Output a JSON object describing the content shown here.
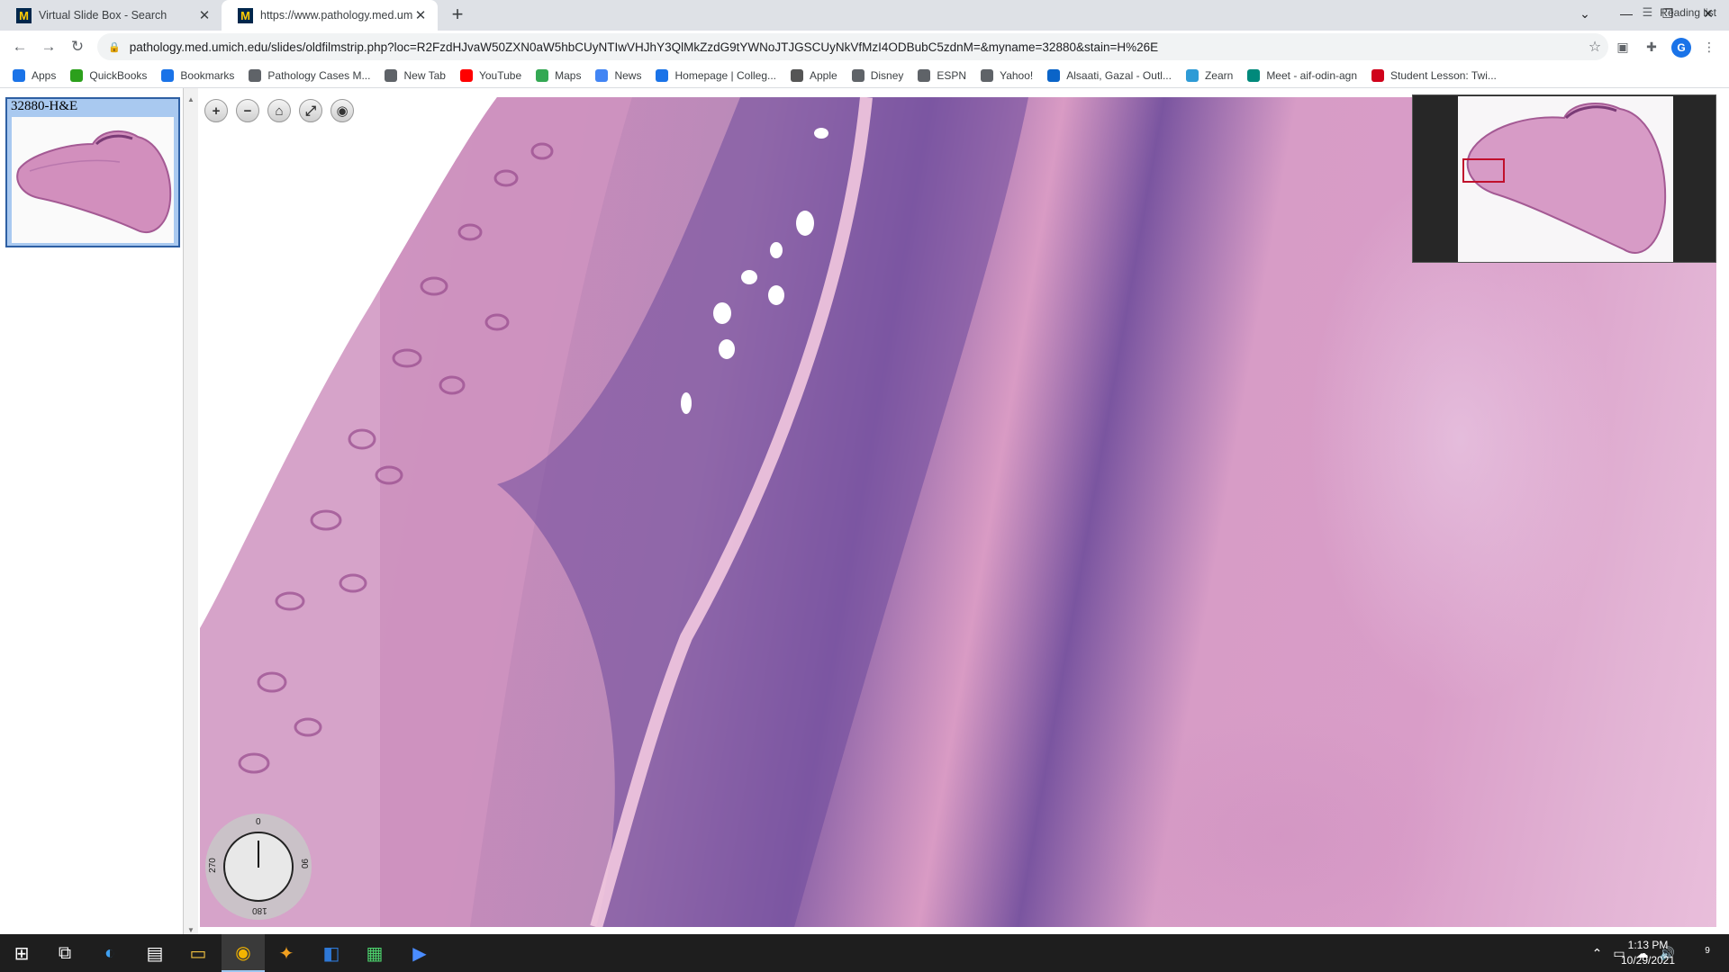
{
  "browser": {
    "tabs": [
      {
        "title": "Virtual Slide Box - Search",
        "favicon": "M",
        "active": false
      },
      {
        "title": "https://www.pathology.med.umi",
        "favicon": "M",
        "active": true
      }
    ],
    "new_tab_icon": "plus-icon",
    "url": "pathology.med.umich.edu/slides/oldfilmstrip.php?loc=R2FzdHJvaW50ZXN0aW5hbCUyNTIwVHJhY3QlMkZzdG9tYWNoJTJGSCUyNkVfMzI4ODBubC5zdnM=&myname=32880&stain=H%26E",
    "profile_initial": "G",
    "bookmarks": [
      {
        "label": "Apps",
        "icon": "apps-grid-icon",
        "color": "#1a73e8"
      },
      {
        "label": "QuickBooks",
        "icon": "quickbooks-icon",
        "color": "#2ca01c"
      },
      {
        "label": "Bookmarks",
        "icon": "star-icon",
        "color": "#1a73e8"
      },
      {
        "label": "Pathology Cases M...",
        "icon": "globe-icon",
        "color": "#5f6368"
      },
      {
        "label": "New Tab",
        "icon": "globe-icon",
        "color": "#5f6368"
      },
      {
        "label": "YouTube",
        "icon": "youtube-icon",
        "color": "#ff0000"
      },
      {
        "label": "Maps",
        "icon": "maps-pin-icon",
        "color": "#34a853"
      },
      {
        "label": "News",
        "icon": "news-icon",
        "color": "#4285f4"
      },
      {
        "label": "Homepage | Colleg...",
        "icon": "college-icon",
        "color": "#1a73e8"
      },
      {
        "label": "Apple",
        "icon": "apple-icon",
        "color": "#555555"
      },
      {
        "label": "Disney",
        "icon": "globe-icon",
        "color": "#5f6368"
      },
      {
        "label": "ESPN",
        "icon": "globe-icon",
        "color": "#5f6368"
      },
      {
        "label": "Yahoo!",
        "icon": "globe-icon",
        "color": "#5f6368"
      },
      {
        "label": "Alsaati, Gazal - Outl...",
        "icon": "outlook-icon",
        "color": "#0a64c8"
      },
      {
        "label": "Zearn",
        "icon": "zearn-icon",
        "color": "#2e9bd6"
      },
      {
        "label": "Meet - aif-odin-agn",
        "icon": "meet-icon",
        "color": "#00897b"
      },
      {
        "label": "Student Lesson: Twi...",
        "icon": "tumblr-icon",
        "color": "#d0021b"
      }
    ],
    "reading_list": "Reading list"
  },
  "viewer": {
    "slide_label": "32880-H&E",
    "zoom_controls": [
      {
        "name": "zoom-in-button",
        "icon": "plus-icon",
        "glyph": "+"
      },
      {
        "name": "zoom-out-button",
        "icon": "minus-icon",
        "glyph": "−"
      },
      {
        "name": "home-button",
        "icon": "home-icon",
        "glyph": "⌂"
      },
      {
        "name": "fullscreen-button",
        "icon": "fullscreen-icon",
        "glyph": "⤢"
      },
      {
        "name": "screenshot-button",
        "icon": "camera-icon",
        "glyph": "◉"
      }
    ],
    "rotation": {
      "top": "0",
      "right": "90",
      "bottom": "180",
      "left": "270",
      "value": 0
    },
    "roi_color": "#c0102c"
  },
  "taskbar": {
    "time": "1:13 PM",
    "date": "10/29/2021",
    "notifications": "9",
    "apps": [
      "windows-start-icon",
      "task-view-icon",
      "edge-icon",
      "store-icon",
      "file-explorer-icon",
      "chrome-icon",
      "app-icon",
      "outlook-icon",
      "app-icon",
      "zoom-icon"
    ]
  }
}
